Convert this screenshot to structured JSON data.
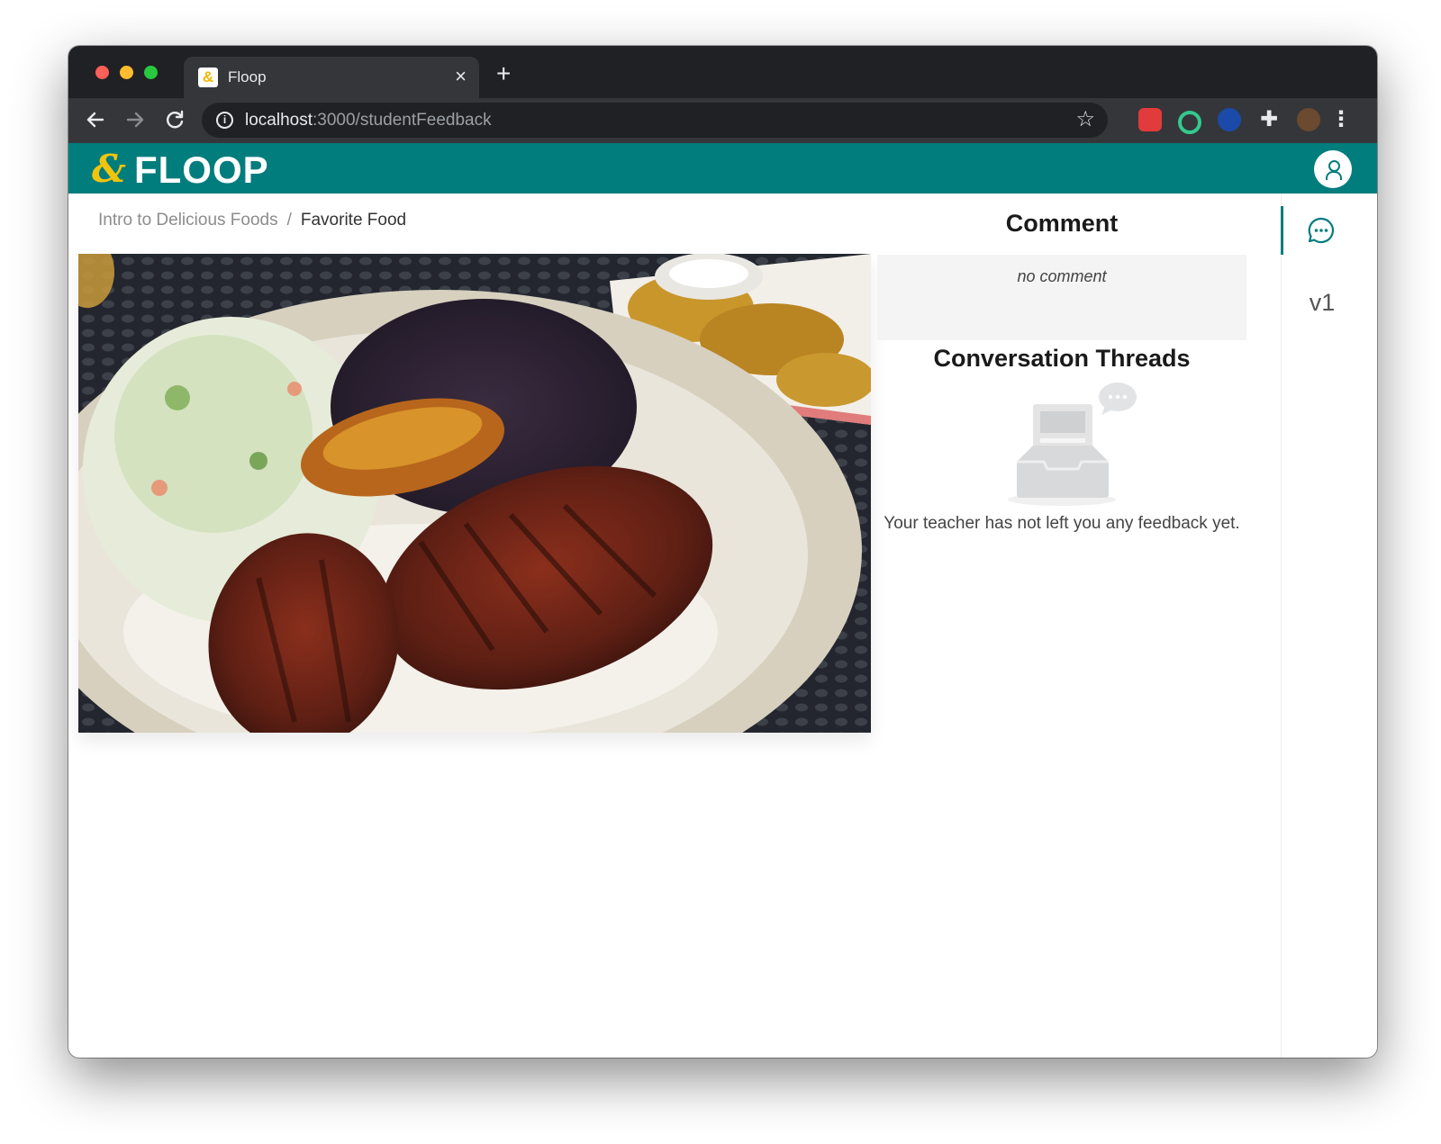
{
  "browser": {
    "tab_title": "Floop",
    "tab_close": "×",
    "new_tab": "+",
    "url_host": "localhost",
    "url_path": ":3000/studentFeedback"
  },
  "app": {
    "logo_mark": "&",
    "logo_text": "FLOOP",
    "brand_color": "#027d7d",
    "accent_color": "#f2c40d"
  },
  "breadcrumb": {
    "parent": "Intro to Delicious Foods",
    "separator": "/",
    "current": "Favorite Food"
  },
  "submission": {
    "image_alt": "Plate with grilled barbecue chicken, rice, coleslaw, black beans, fried plantain and tostones"
  },
  "feedback": {
    "comment_title": "Comment",
    "comment_text": "no comment",
    "threads_title": "Conversation Threads",
    "empty_message": "Your teacher has not left you any feedback yet."
  },
  "rail": {
    "version_label": "v1"
  },
  "icons": [
    "info-icon",
    "star-icon",
    "extension-icon",
    "user-icon",
    "chat-icon",
    "empty-inbox-icon"
  ]
}
